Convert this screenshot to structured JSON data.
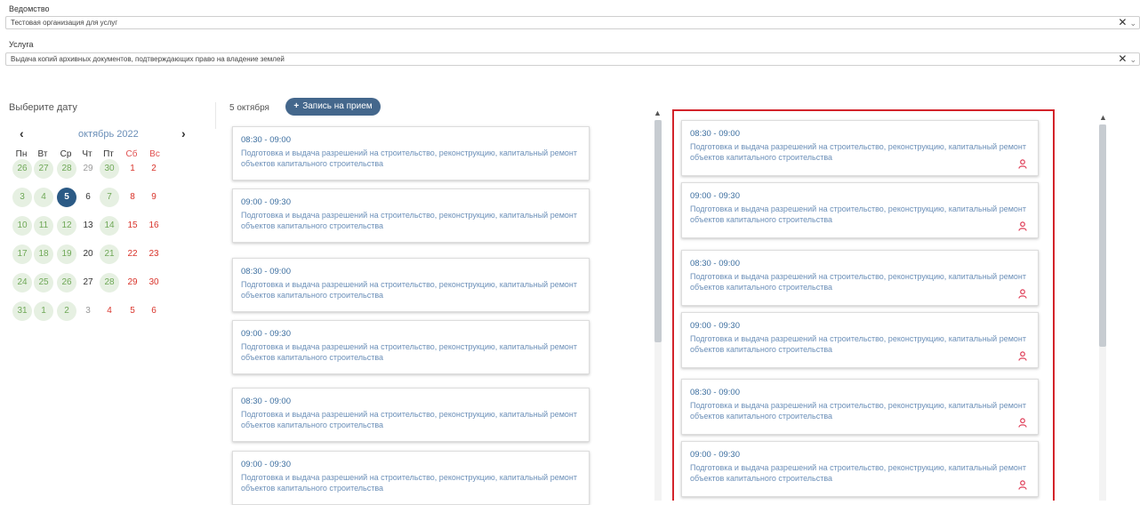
{
  "department": {
    "label": "Ведомство",
    "value": "Тестовая организация для услуг",
    "clear_icon": "close-icon",
    "dropdown_icon": "chevron-down-icon"
  },
  "service": {
    "label": "Услуга",
    "value": "Выдача копий архивных документов, подтверждающих право на владение землей",
    "clear_icon": "close-icon",
    "dropdown_icon": "chevron-down-icon"
  },
  "calendar": {
    "title": "Выберите дату",
    "month": "октябрь 2022",
    "weekdays": [
      "Пн",
      "Вт",
      "Ср",
      "Чт",
      "Пт",
      "Сб",
      "Вс"
    ],
    "weeks": [
      [
        "26",
        "27",
        "28",
        "29",
        "30",
        "1",
        "2"
      ],
      [
        "3",
        "4",
        "5",
        "6",
        "7",
        "8",
        "9"
      ],
      [
        "10",
        "11",
        "12",
        "13",
        "14",
        "15",
        "16"
      ],
      [
        "17",
        "18",
        "19",
        "20",
        "21",
        "22",
        "23"
      ],
      [
        "24",
        "25",
        "26",
        "27",
        "28",
        "29",
        "30"
      ],
      [
        "31",
        "1",
        "2",
        "3",
        "4",
        "5",
        "6"
      ]
    ],
    "selected": "5"
  },
  "schedule": {
    "date_label": "5 октября",
    "add_button": "Запись на прием",
    "left_slots": [
      {
        "time": "08:30 - 09:00",
        "description": "Подготовка и выдача разрешений на строительство, реконструкцию, капитальный ремонт объектов капитального строительства"
      },
      {
        "time": "09:00 - 09:30",
        "description": "Подготовка и выдача разрешений на строительство, реконструкцию, капитальный ремонт объектов капитального строительства"
      },
      {
        "time": "08:30 - 09:00",
        "description": "Подготовка и выдача разрешений на строительство, реконструкцию, капитальный ремонт объектов капитального строительства"
      },
      {
        "time": "09:00 - 09:30",
        "description": "Подготовка и выдача разрешений на строительство, реконструкцию, капитальный ремонт объектов капитального строительства"
      },
      {
        "time": "08:30 - 09:00",
        "description": "Подготовка и выдача разрешений на строительство, реконструкцию, капитальный ремонт объектов капитального строительства"
      },
      {
        "time": "09:00 - 09:30",
        "description": "Подготовка и выдача разрешений на строительство, реконструкцию, капитальный ремонт объектов капитального строительства"
      }
    ],
    "right_slots": [
      {
        "time": "08:30 - 09:00",
        "description": "Подготовка и выдача разрешений на строительство, реконструкцию, капитальный ремонт объектов капитального строительства",
        "icon": "person-icon"
      },
      {
        "time": "09:00 - 09:30",
        "description": "Подготовка и выдача разрешений на строительство, реконструкцию, капитальный ремонт объектов капитального строительства",
        "icon": "person-icon"
      },
      {
        "time": "08:30 - 09:00",
        "description": "Подготовка и выдача разрешений на строительство, реконструкцию, капитальный ремонт объектов капитального строительства",
        "icon": "person-icon"
      },
      {
        "time": "09:00 - 09:30",
        "description": "Подготовка и выдача разрешений на строительство, реконструкцию, капитальный ремонт объектов капитального строительства",
        "icon": "person-icon"
      },
      {
        "time": "08:30 - 09:00",
        "description": "Подготовка и выдача разрешений на строительство, реконструкцию, капитальный ремонт объектов капитального строительства",
        "icon": "person-icon"
      },
      {
        "time": "09:00 - 09:30",
        "description": "Подготовка и выдача разрешений на строительство, реконструкцию, капитальный ремонт объектов капитального строительства",
        "icon": "person-icon"
      }
    ]
  },
  "colors": {
    "accent": "#44678c",
    "selected_day": "#2b5a85",
    "weekend": "#d9342b",
    "available_bg": "#e6f0e2",
    "available_text": "#6fa857",
    "highlight_border": "#d3232a",
    "person_icon": "#e0405a"
  }
}
